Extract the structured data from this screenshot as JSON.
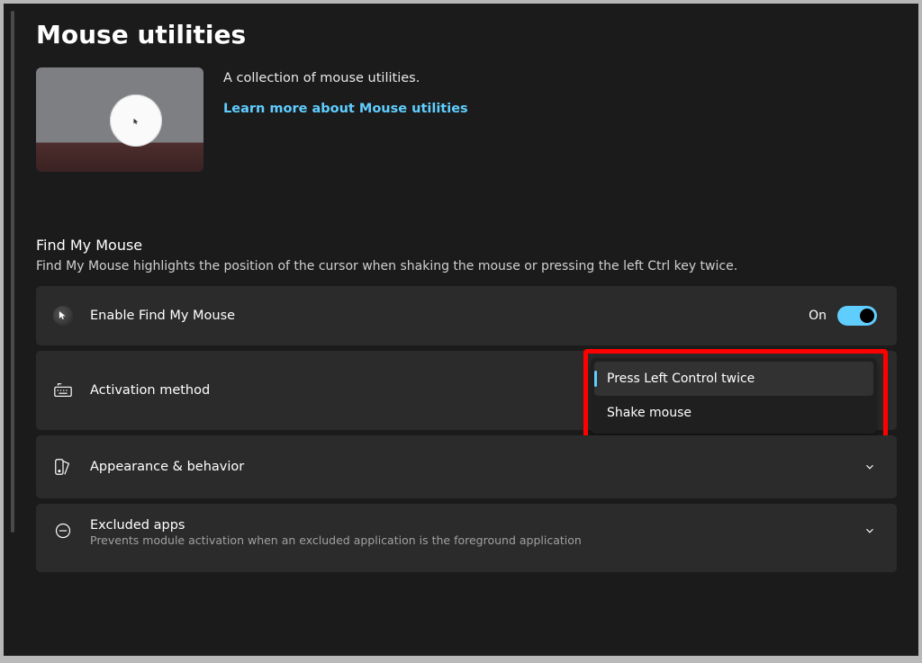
{
  "page": {
    "title": "Mouse utilities"
  },
  "hero": {
    "description": "A collection of mouse utilities.",
    "link_text": "Learn more about Mouse utilities"
  },
  "section": {
    "heading": "Find My Mouse",
    "subheading": "Find My Mouse highlights the position of the cursor when shaking the mouse or pressing the left Ctrl key twice."
  },
  "enable_row": {
    "label": "Enable Find My Mouse",
    "state": "On"
  },
  "activation_row": {
    "label": "Activation method",
    "options": [
      "Press Left Control twice",
      "Shake mouse"
    ],
    "selected_index": 0
  },
  "appearance_row": {
    "label": "Appearance & behavior"
  },
  "excluded_row": {
    "title": "Excluded apps",
    "sub": "Prevents module activation when an excluded application is the foreground application"
  },
  "colors": {
    "accent": "#60cdff",
    "highlight": "#ff0000"
  }
}
